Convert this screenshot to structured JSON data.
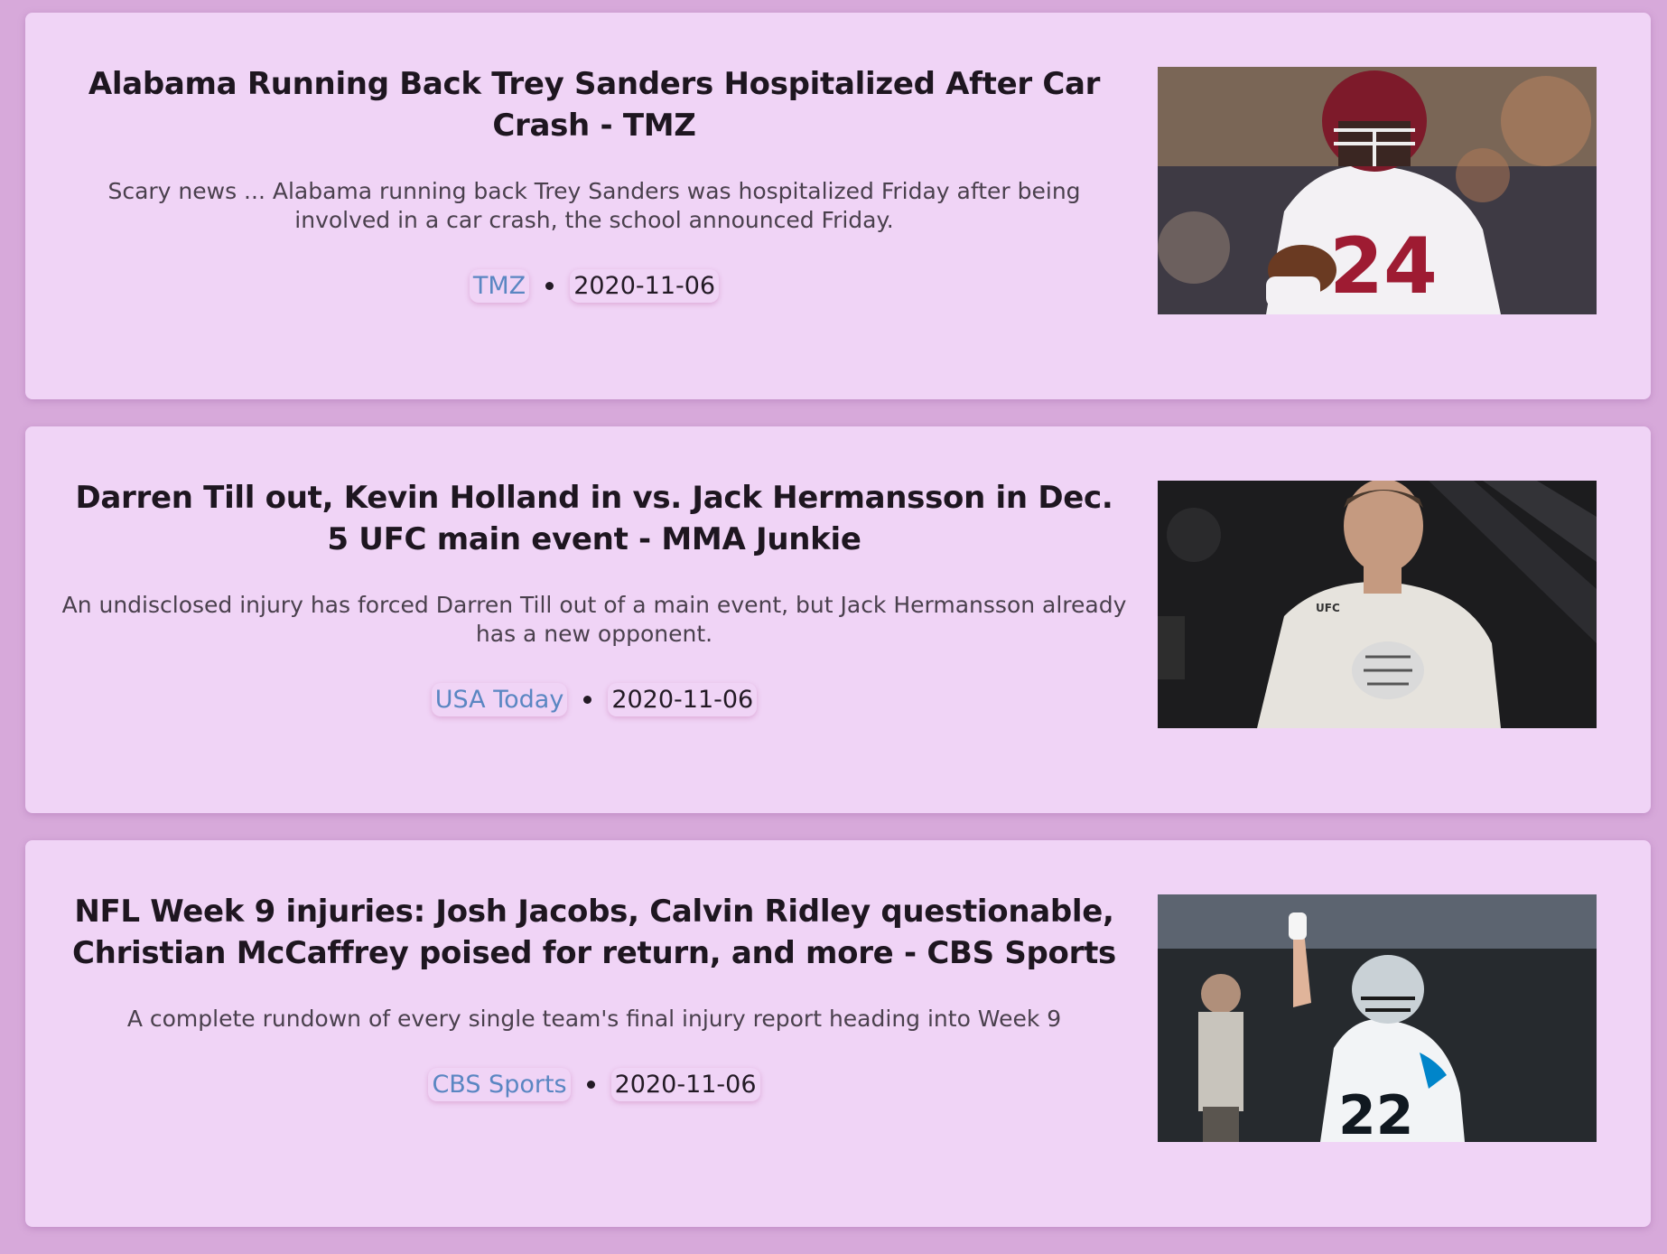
{
  "articles": [
    {
      "title": "Alabama Running Back Trey Sanders Hospitalized After Car Crash - TMZ",
      "description": "Scary news ... Alabama running back Trey Sanders was hospitalized Friday after being involved in a car crash, the school announced Friday.",
      "source": "TMZ",
      "date": "2020-11-06",
      "image_alt": "football player in crimson helmet and white jersey number 24",
      "jersey_number": "24"
    },
    {
      "title": "Darren Till out, Kevin Holland in vs. Jack Hermansson in Dec. 5 UFC main event - MMA Junkie",
      "description": "An undisclosed injury has forced Darren Till out of a main event, but Jack Hermansson already has a new opponent.",
      "source": "USA Today",
      "date": "2020-11-06",
      "image_alt": "UFC fighter in white t-shirt with taped hand",
      "shirt_logo": "UFC"
    },
    {
      "title": "NFL Week 9 injuries: Josh Jacobs, Calvin Ridley questionable, Christian McCaffrey poised for return, and more - CBS Sports",
      "description": "A complete rundown of every single team's final injury report heading into Week 9",
      "source": "CBS Sports",
      "date": "2020-11-06",
      "image_alt": "football player in white Panthers jersey pointing upward",
      "jersey_number": "22"
    }
  ],
  "colors": {
    "page_background": "#d7a9da",
    "card_background": "#f0d4f6",
    "source_link": "#5a86c2",
    "title_text": "#1e1620"
  }
}
